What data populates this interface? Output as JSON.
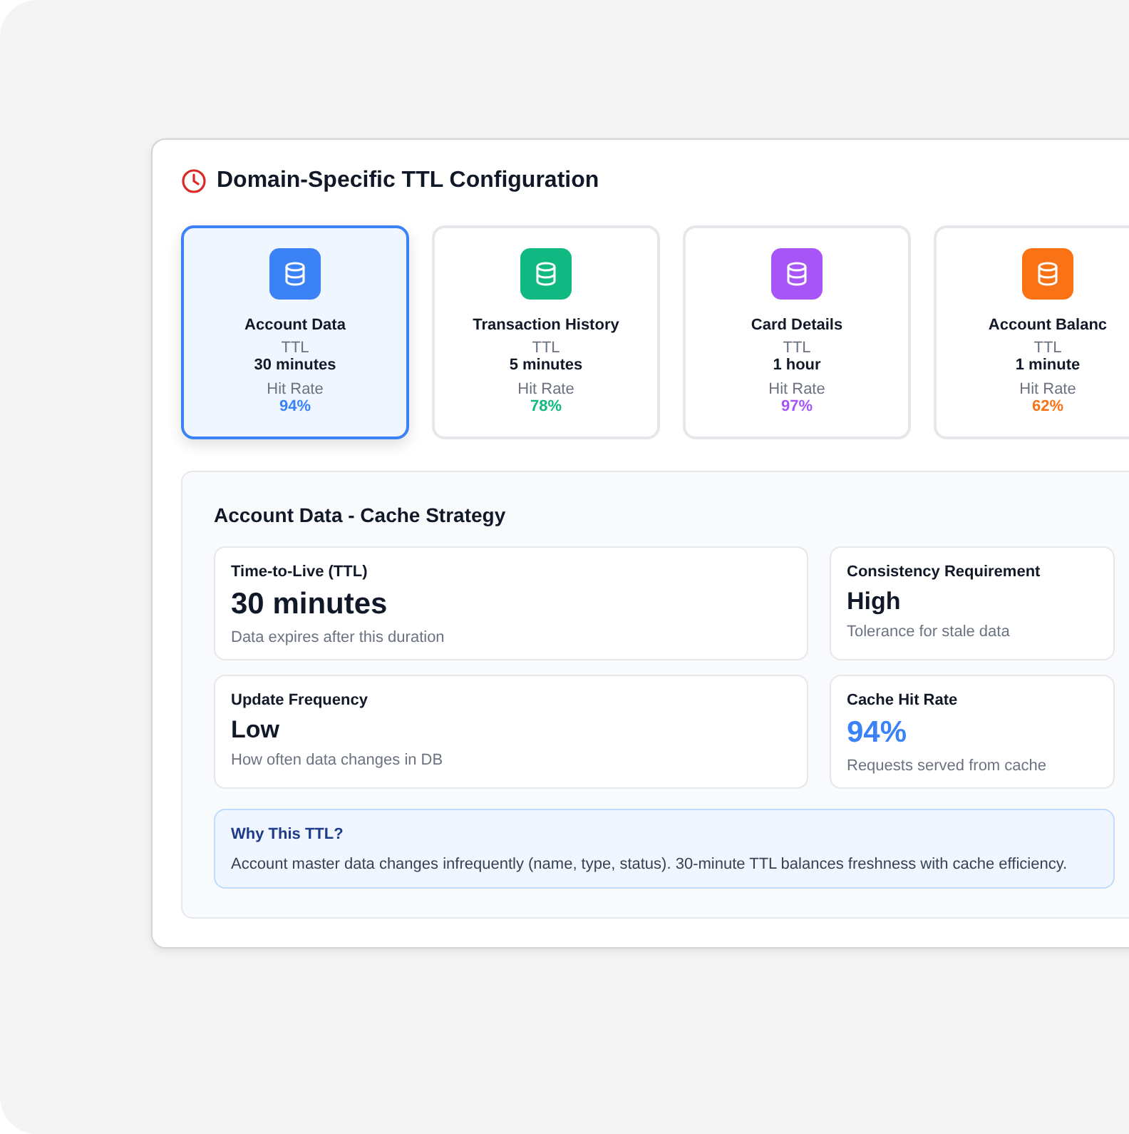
{
  "title": "Domain-Specific TTL Configuration",
  "domains": [
    {
      "name": "Account Data",
      "ttl_label": "TTL",
      "ttl": "30 minutes",
      "hit_label": "Hit Rate",
      "hit_rate": "94%",
      "color": "#3b82f6",
      "selected": true
    },
    {
      "name": "Transaction History",
      "ttl_label": "TTL",
      "ttl": "5 minutes",
      "hit_label": "Hit Rate",
      "hit_rate": "78%",
      "color": "#10b981",
      "selected": false
    },
    {
      "name": "Card Details",
      "ttl_label": "TTL",
      "ttl": "1 hour",
      "hit_label": "Hit Rate",
      "hit_rate": "97%",
      "color": "#a855f7",
      "selected": false
    },
    {
      "name": "Account Balanc",
      "ttl_label": "TTL",
      "ttl": "1 minute",
      "hit_label": "Hit Rate",
      "hit_rate": "62%",
      "color": "#f97316",
      "selected": false
    }
  ],
  "strategy": {
    "title": "Account Data - Cache Strategy",
    "metrics": [
      {
        "label": "Time-to-Live (TTL)",
        "value": "30 minutes",
        "note": "Data expires after this duration",
        "kind": "large"
      },
      {
        "label": "Consistency Requirement",
        "value": "High",
        "note": "Tolerance for stale data",
        "kind": "plain"
      },
      {
        "label": "Update Frequency",
        "value": "Low",
        "note": "How often data changes in DB",
        "kind": "plain"
      },
      {
        "label": "Cache Hit Rate",
        "value": "94%",
        "note": "Requests served from cache",
        "kind": "accent"
      }
    ],
    "why": {
      "title": "Why This TTL?",
      "text": "Account master data changes infrequently (name, type, status). 30-minute TTL balances freshness with cache efficiency."
    }
  }
}
